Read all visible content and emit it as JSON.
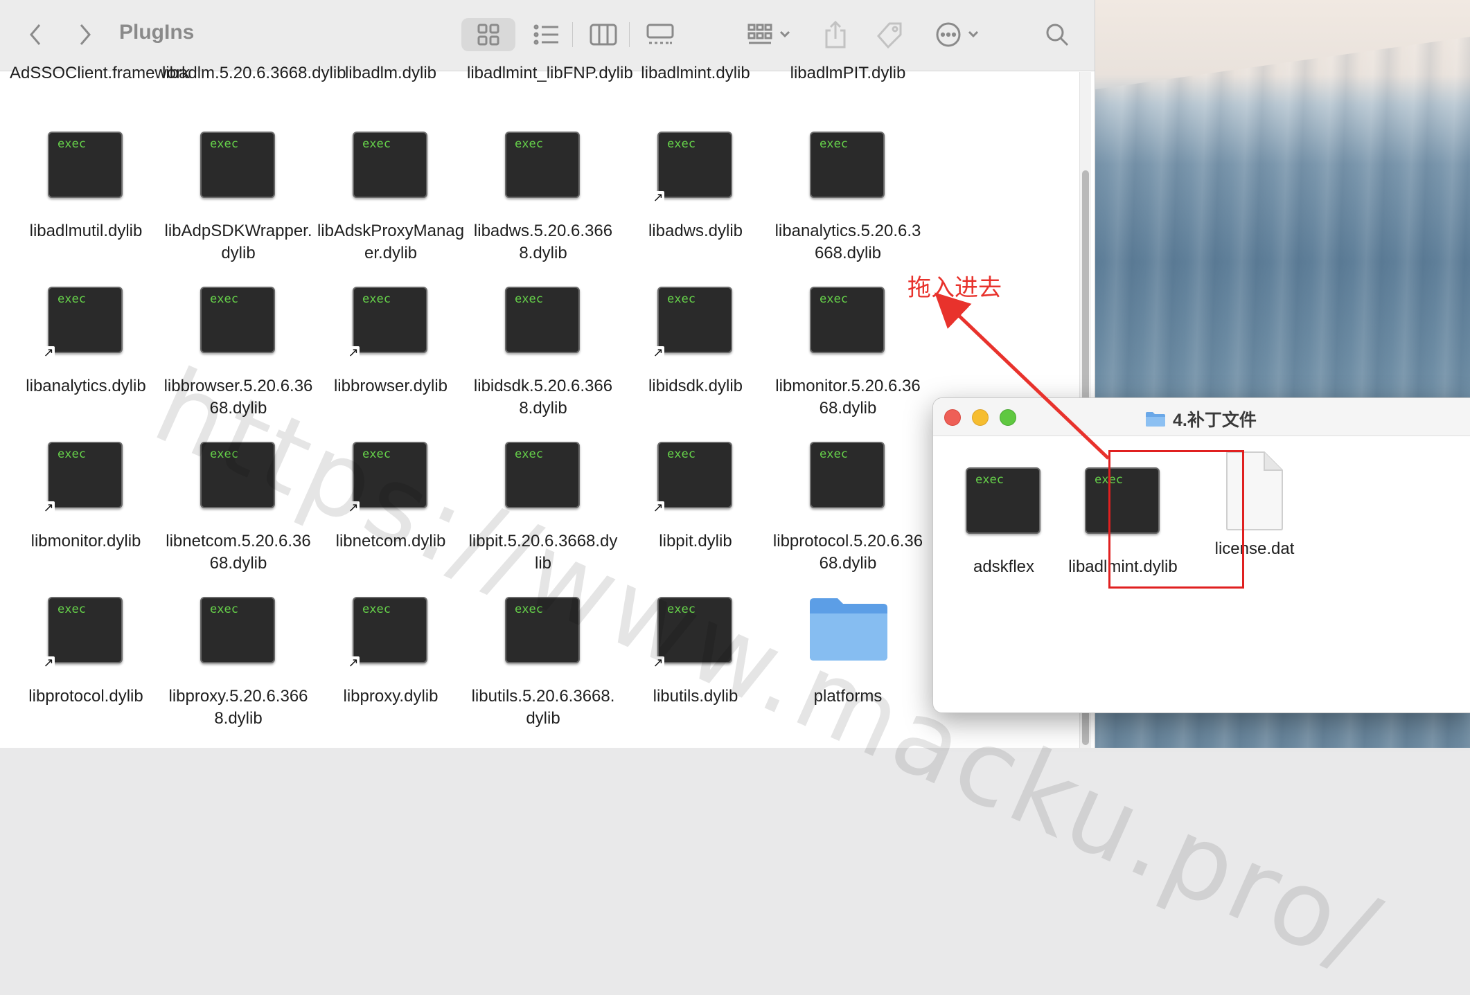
{
  "finder": {
    "title": "PlugIns",
    "top_row": [
      "AdSSOClient.framework",
      "libadlm.5.20.6.3668.dylib",
      "libadlm.dylib",
      "libadlmint_libFNP.dylib",
      "libadlmint.dylib",
      "libadlmPIT.dylib"
    ],
    "rows": [
      [
        {
          "name": "libadlmutil.dylib",
          "alias": false
        },
        {
          "name": "libAdpSDKWrapper.dylib",
          "alias": false
        },
        {
          "name": "libAdskProxyManager.dylib",
          "alias": false
        },
        {
          "name": "libadws.5.20.6.3668.dylib",
          "alias": false
        },
        {
          "name": "libadws.dylib",
          "alias": true
        },
        {
          "name": "libanalytics.5.20.6.3668.dylib",
          "alias": false
        }
      ],
      [
        {
          "name": "libanalytics.dylib",
          "alias": true
        },
        {
          "name": "libbrowser.5.20.6.3668.dylib",
          "alias": false
        },
        {
          "name": "libbrowser.dylib",
          "alias": true
        },
        {
          "name": "libidsdk.5.20.6.3668.dylib",
          "alias": false
        },
        {
          "name": "libidsdk.dylib",
          "alias": true
        },
        {
          "name": "libmonitor.5.20.6.3668.dylib",
          "alias": false
        }
      ],
      [
        {
          "name": "libmonitor.dylib",
          "alias": true
        },
        {
          "name": "libnetcom.5.20.6.3668.dylib",
          "alias": false
        },
        {
          "name": "libnetcom.dylib",
          "alias": true
        },
        {
          "name": "libpit.5.20.6.3668.dylib",
          "alias": false
        },
        {
          "name": "libpit.dylib",
          "alias": true
        },
        {
          "name": "libprotocol.5.20.6.3668.dylib",
          "alias": false
        }
      ],
      [
        {
          "name": "libprotocol.dylib",
          "alias": true
        },
        {
          "name": "libproxy.5.20.6.3668.dylib",
          "alias": false
        },
        {
          "name": "libproxy.dylib",
          "alias": true
        },
        {
          "name": "libutils.5.20.6.3668.dylib",
          "alias": false
        },
        {
          "name": "libutils.dylib",
          "alias": true
        },
        {
          "name": "platforms",
          "folder": true
        }
      ]
    ],
    "exec_label": "exec"
  },
  "patch_window": {
    "title": "4.补丁文件",
    "items": [
      {
        "name": "adskflex",
        "kind": "exec"
      },
      {
        "name": "libadlmint.dylib",
        "kind": "exec"
      },
      {
        "name": "license.dat",
        "kind": "document"
      }
    ]
  },
  "annotation": {
    "text": "拖入进去",
    "color": "#e8322c"
  },
  "watermark": "https://www.macku.pro/",
  "colors": {
    "exec_text": "#66d24a",
    "highlight": "#e02020",
    "folder": "#7fb6ef"
  },
  "icons": {
    "nav_back": "chevron-left-icon",
    "nav_forward": "chevron-right-icon",
    "views": [
      "grid-view-icon",
      "list-view-icon",
      "column-view-icon",
      "gallery-view-icon"
    ],
    "group": "group-icon",
    "share": "share-icon",
    "tag": "tag-icon",
    "action": "ellipsis-circle-icon",
    "search": "search-icon"
  }
}
